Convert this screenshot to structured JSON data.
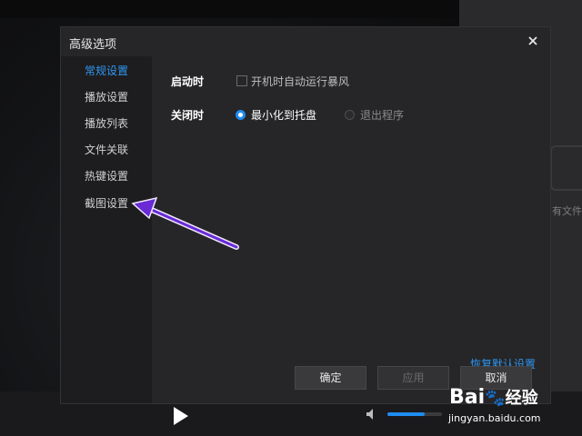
{
  "dialog": {
    "title": "高级选项",
    "sidebar": {
      "items": [
        {
          "label": "常规设置",
          "active": true
        },
        {
          "label": "播放设置",
          "active": false
        },
        {
          "label": "播放列表",
          "active": false
        },
        {
          "label": "文件关联",
          "active": false
        },
        {
          "label": "热键设置",
          "active": false
        },
        {
          "label": "截图设置",
          "active": false
        }
      ]
    },
    "startup": {
      "label": "启动时",
      "autorun_label": "开机时自动运行暴风",
      "autorun_checked": false
    },
    "close": {
      "label": "关闭时",
      "options": [
        {
          "label": "最小化到托盘",
          "selected": true
        },
        {
          "label": "退出程序",
          "selected": false
        }
      ]
    },
    "restore_link": "恢复默认设置",
    "buttons": {
      "ok": "确定",
      "apply": "应用",
      "cancel": "取消"
    }
  },
  "background": {
    "side_text": "有文件",
    "volume_level": 0.68
  },
  "watermark": {
    "brand": "Bai",
    "brand_cn": "经验",
    "url": "jingyan.baidu.com"
  },
  "colors": {
    "accent": "#1e8cf0",
    "active_text": "#2f96f2",
    "arrow": "#6a2ad6"
  }
}
